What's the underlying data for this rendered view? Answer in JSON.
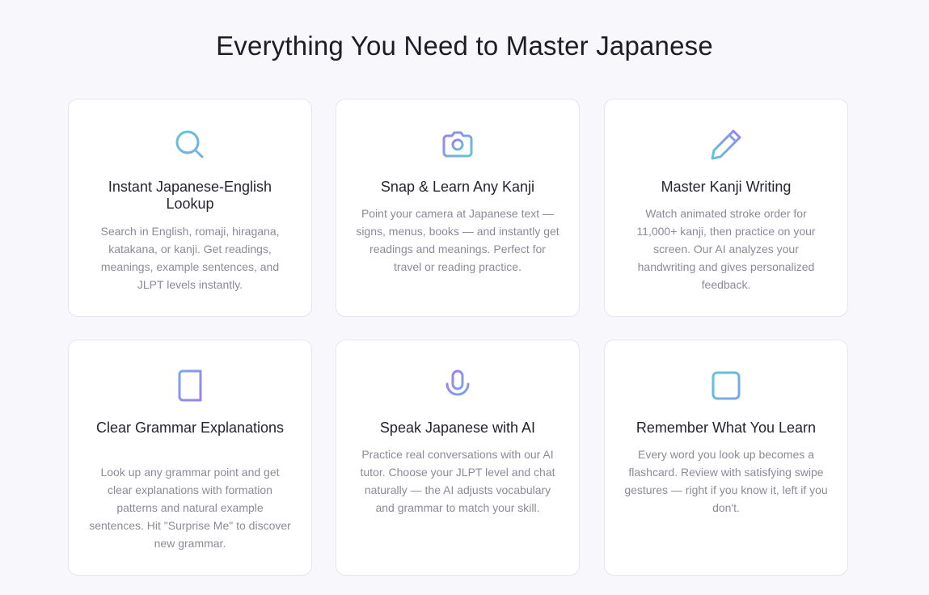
{
  "heading": "Everything You Need to Master Japanese",
  "colors": {
    "teal": "#5ec8d4",
    "blue": "#7aa6e8",
    "purple": "#9b7ff0"
  },
  "features": [
    {
      "icon": "search-icon",
      "title": "Instant Japanese-English Lookup",
      "description": "Search in English, romaji, hiragana, katakana, or kanji. Get readings, meanings, example sentences, and JLPT levels instantly."
    },
    {
      "icon": "camera-icon",
      "title": "Snap & Learn Any Kanji",
      "description": "Point your camera at Japanese text — signs, menus, books — and instantly get readings and meanings. Perfect for travel or reading practice."
    },
    {
      "icon": "pencil-icon",
      "title": "Master Kanji Writing",
      "description": "Watch animated stroke order for 11,000+ kanji, then practice on your screen. Our AI analyzes your handwriting and gives personalized feedback."
    },
    {
      "icon": "book-icon",
      "title": "Clear Grammar Explanations",
      "description": "Look up any grammar point and get clear explanations with formation patterns and natural example sentences. Hit \"Surprise Me\" to discover new grammar."
    },
    {
      "icon": "microphone-icon",
      "title": "Speak Japanese with AI",
      "description": "Practice real conversations with our AI tutor. Choose your JLPT level and chat naturally — the AI adjusts vocabulary and grammar to match your skill."
    },
    {
      "icon": "square-icon",
      "title": "Remember What You Learn",
      "description": "Every word you look up becomes a flashcard. Review with satisfying swipe gestures — right if you know it, left if you don't."
    }
  ]
}
